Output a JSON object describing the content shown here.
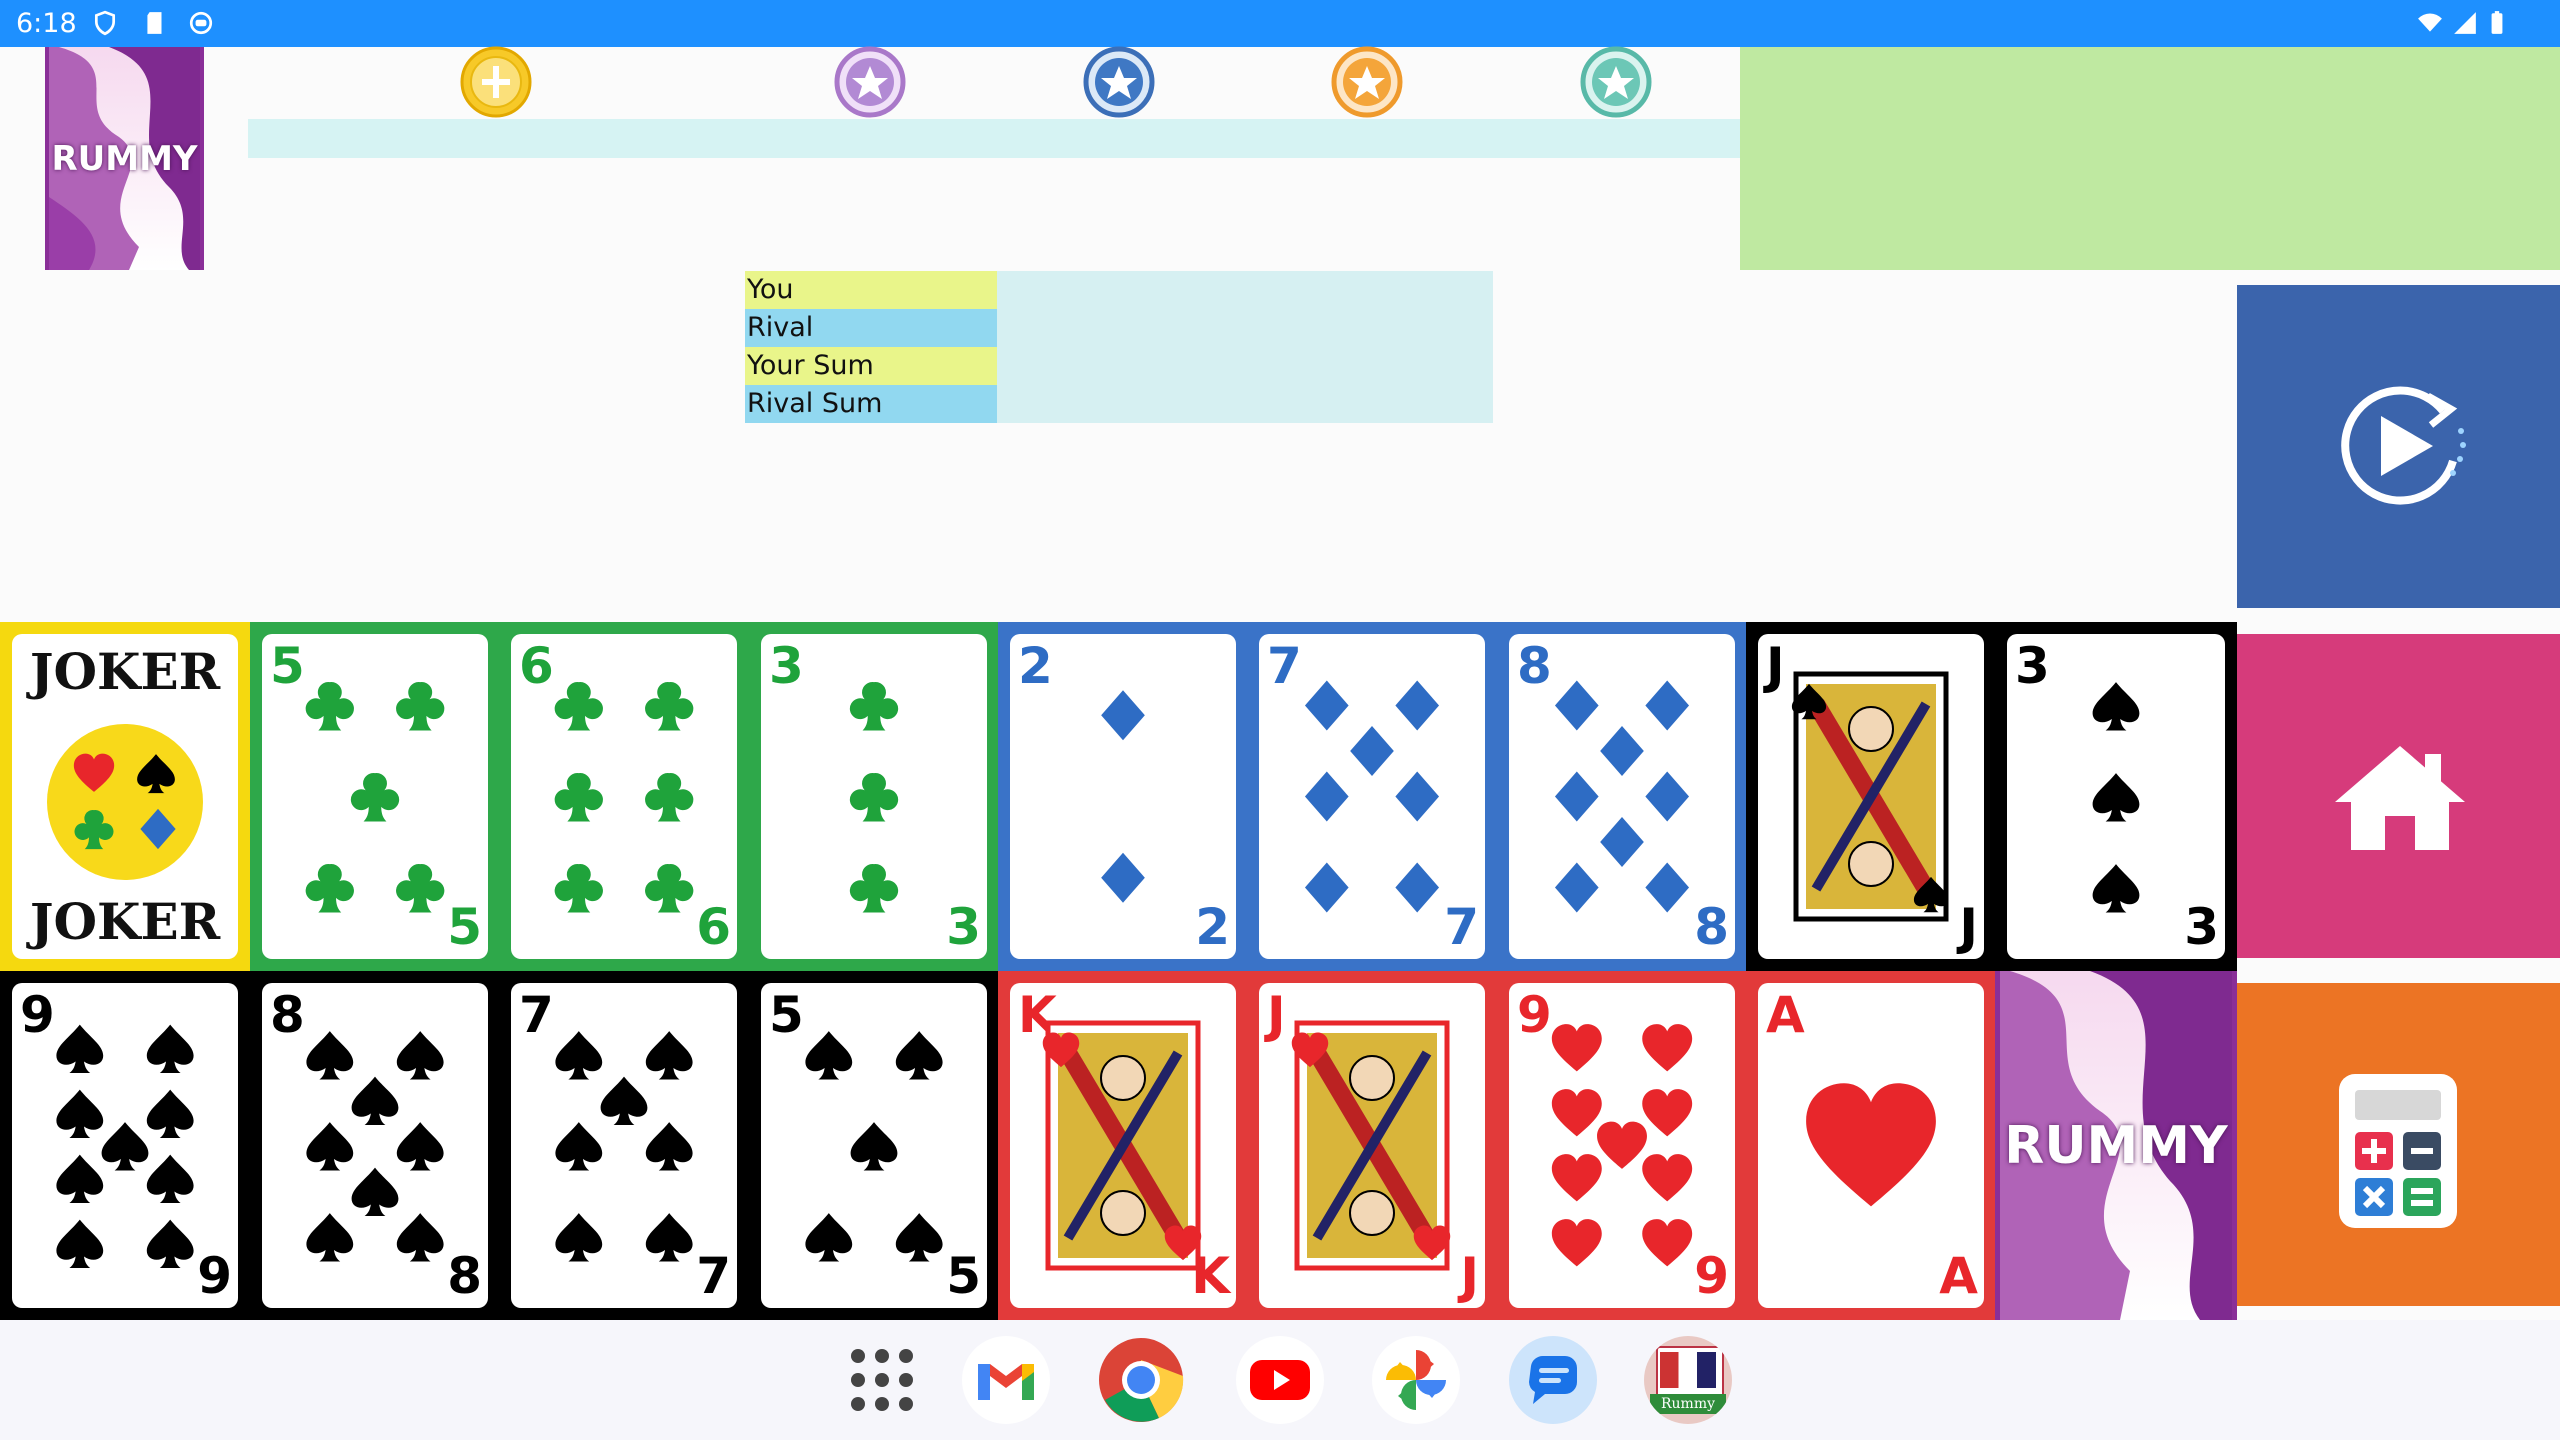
{
  "status_bar": {
    "time": "6:18"
  },
  "deck": {
    "label": "RUMMY"
  },
  "score_table": {
    "rows": [
      {
        "label": "You",
        "color": "#e9f58a"
      },
      {
        "label": "Rival",
        "color": "#91d8f0"
      },
      {
        "label": "Your Sum",
        "color": "#e9f58a"
      },
      {
        "label": "Rival Sum",
        "color": "#91d8f0"
      }
    ]
  },
  "progress_icons": [
    "gold-coin-icon",
    "purple-star-icon",
    "blue-star-icon",
    "orange-star-icon",
    "teal-star-icon"
  ],
  "buttons": {
    "play": "replay-icon",
    "home": "home-icon",
    "calc": "calculator-icon"
  },
  "hand_row_1": [
    {
      "rank": "JOKER",
      "suit": "joker",
      "group_color": "#f5d90f"
    },
    {
      "rank": "5",
      "suit": "clubs",
      "group_color": "#2ea84a"
    },
    {
      "rank": "6",
      "suit": "clubs",
      "group_color": "#2ea84a"
    },
    {
      "rank": "3",
      "suit": "clubs",
      "group_color": "#2ea84a"
    },
    {
      "rank": "2",
      "suit": "diamonds",
      "group_color": "#3a73c8"
    },
    {
      "rank": "7",
      "suit": "diamonds",
      "group_color": "#3a73c8"
    },
    {
      "rank": "8",
      "suit": "diamonds",
      "group_color": "#3a73c8"
    },
    {
      "rank": "J",
      "suit": "spades",
      "group_color": "#000000"
    },
    {
      "rank": "3",
      "suit": "spades",
      "group_color": "#000000"
    }
  ],
  "hand_row_2": [
    {
      "rank": "9",
      "suit": "spades",
      "group_color": "#000000"
    },
    {
      "rank": "8",
      "suit": "spades",
      "group_color": "#000000"
    },
    {
      "rank": "7",
      "suit": "spades",
      "group_color": "#000000"
    },
    {
      "rank": "5",
      "suit": "spades",
      "group_color": "#000000"
    },
    {
      "rank": "K",
      "suit": "hearts",
      "group_color": "#e23a3a"
    },
    {
      "rank": "J",
      "suit": "hearts",
      "group_color": "#e23a3a"
    },
    {
      "rank": "9",
      "suit": "hearts",
      "group_color": "#e23a3a"
    },
    {
      "rank": "A",
      "suit": "hearts",
      "group_color": "#e23a3a"
    },
    {
      "rank": "RUMMY",
      "suit": "back",
      "group_color": "#8a2f98"
    }
  ],
  "dock": {
    "apps": [
      "app-drawer-icon",
      "gmail-icon",
      "chrome-icon",
      "youtube-icon",
      "photos-icon",
      "messages-icon",
      "rummy-app-icon"
    ],
    "rummy_label": "Rummy"
  }
}
